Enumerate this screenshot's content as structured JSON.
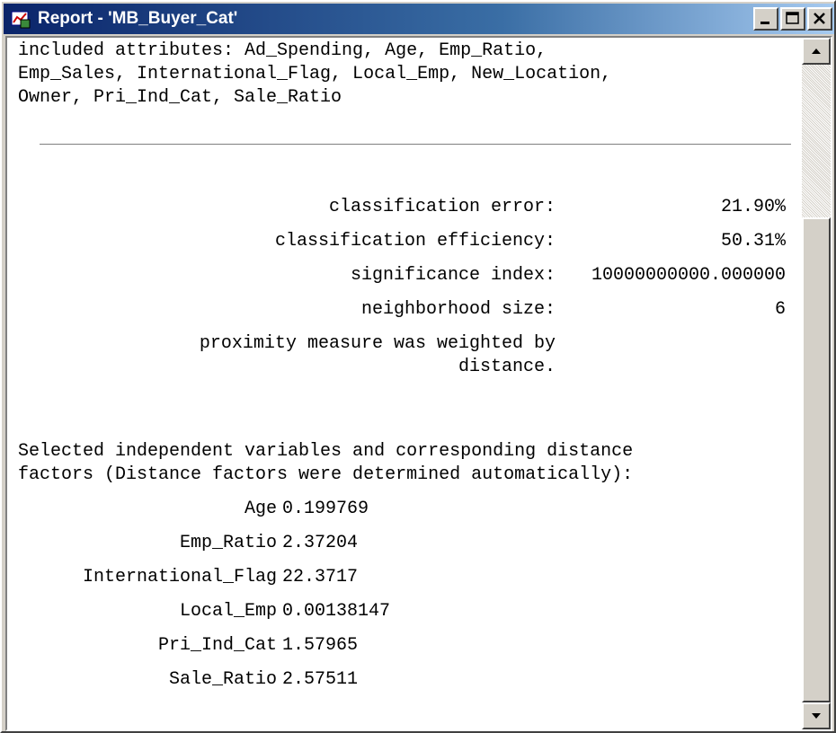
{
  "window": {
    "title": "Report - 'MB_Buyer_Cat'",
    "title_bar_color": "#0a246a",
    "controls": [
      "minimize-icon",
      "maximize-icon",
      "close-icon"
    ]
  },
  "report": {
    "attributes_lines": [
      "included attributes: Ad_Spending, Age, Emp_Ratio,",
      "Emp_Sales, International_Flag, Local_Emp, New_Location,",
      "Owner, Pri_Ind_Cat, Sale_Ratio"
    ],
    "stats": [
      {
        "label": "classification error:",
        "value": "21.90%"
      },
      {
        "label": "classification efficiency:",
        "value": "50.31%"
      },
      {
        "label": "significance index:",
        "value": "10000000000.000000"
      },
      {
        "label": "neighborhood size:",
        "value": "6"
      }
    ],
    "proximity_lines": [
      "proximity measure was weighted by",
      "distance."
    ],
    "selected_heading_lines": [
      "Selected independent variables and corresponding distance",
      "factors (Distance factors were determined automatically):"
    ],
    "variables": [
      {
        "name": "Age",
        "factor": "0.199769"
      },
      {
        "name": "Emp_Ratio",
        "factor": "2.37204"
      },
      {
        "name": "International_Flag",
        "factor": "22.3717"
      },
      {
        "name": "Local_Emp",
        "factor": "0.00138147"
      },
      {
        "name": "Pri_Ind_Cat",
        "factor": "1.57965"
      },
      {
        "name": "Sale_Ratio",
        "factor": "2.57511"
      }
    ]
  },
  "scrollbar": {
    "position_fraction": 0.0
  }
}
